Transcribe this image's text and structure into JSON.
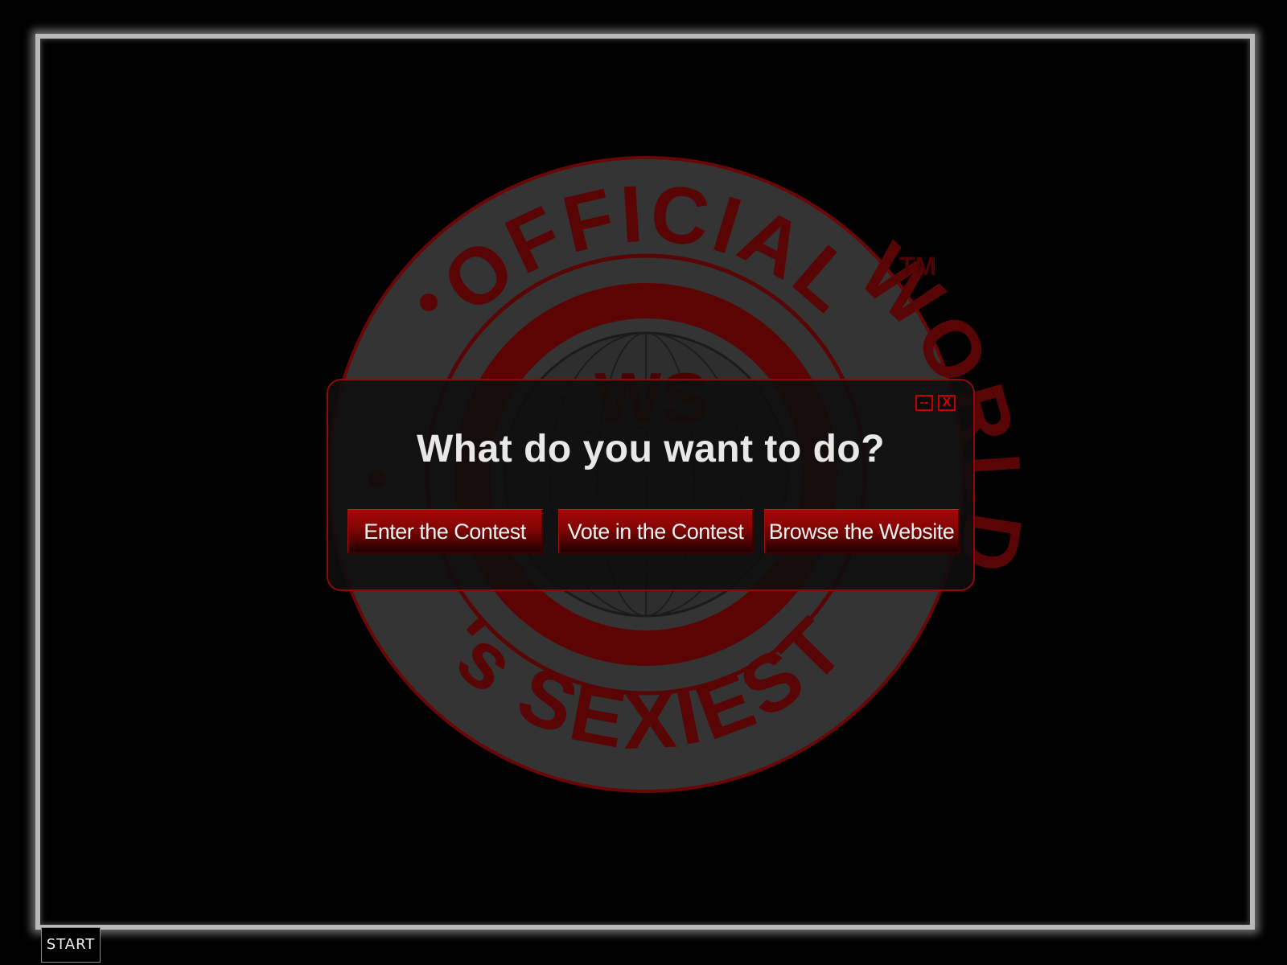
{
  "emblem": {
    "arc_top_text": "OFFICIAL",
    "arc_right_text": "WORLD",
    "arc_bottom_text": "'s SEXIEST",
    "trademark": "TM",
    "center_letters": "WS",
    "colors": {
      "ring_gray": "#363636",
      "mark_red": "#5a0505",
      "outline_red": "#7a0707"
    }
  },
  "dialog": {
    "title": "What do you want to do?",
    "minimize_label": "--",
    "close_label": "X",
    "buttons": [
      {
        "label": "Enter the Contest"
      },
      {
        "label": "Vote in the Contest"
      },
      {
        "label": "Browse the Website"
      }
    ],
    "colors": {
      "border": "#8e0a0a",
      "button_top": "#a50808",
      "button_bottom": "#1c0000",
      "title_text": "#e8e8e8"
    }
  },
  "taskbar": {
    "start_label": "START"
  }
}
